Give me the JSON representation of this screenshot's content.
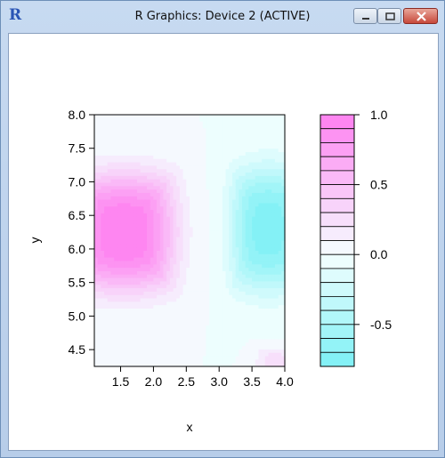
{
  "window": {
    "title": "R Graphics: Device 2 (ACTIVE)",
    "app_icon_label": "R",
    "controls": [
      "minimize",
      "maximize",
      "close"
    ]
  },
  "chart_data": {
    "type": "heatmap",
    "title": "",
    "xlabel": "x",
    "ylabel": "y",
    "xlim": [
      1.1,
      4.0
    ],
    "ylim": [
      4.25,
      8.0
    ],
    "x_ticks": [
      "1.5",
      "2.0",
      "2.5",
      "3.0",
      "3.5",
      "4.0"
    ],
    "y_ticks": [
      "4.5",
      "5.0",
      "5.5",
      "6.0",
      "6.5",
      "7.0",
      "7.5",
      "8.0"
    ],
    "features": [
      {
        "label": "max",
        "x": 1.55,
        "y": 6.25,
        "value": 1.0
      },
      {
        "label": "min",
        "x": 3.75,
        "y": 6.3,
        "value": -0.75
      },
      {
        "label": "secondary-positive",
        "x": 3.85,
        "y": 4.3,
        "value": 0.25
      }
    ],
    "colorbar": {
      "ticks": [
        "1.0",
        "0.5",
        "0.0",
        "-0.5"
      ],
      "levels": [
        1.0,
        0.9,
        0.8,
        0.7,
        0.6,
        0.5,
        0.4,
        0.3,
        0.2,
        0.1,
        0.0,
        -0.1,
        -0.2,
        -0.3,
        -0.4,
        -0.5,
        -0.6,
        -0.7,
        -0.8
      ],
      "low_color": "#7df0f5",
      "mid_color": "#f4ffff",
      "high_color": "#ff80f0"
    }
  }
}
